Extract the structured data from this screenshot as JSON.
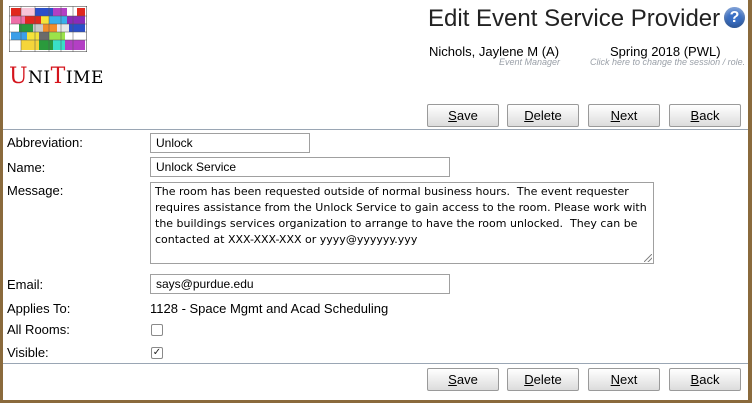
{
  "app": {
    "logo_uni": "Uni",
    "logo_time": "Time",
    "logo_u": "U",
    "logo_t": "T"
  },
  "header": {
    "title": "Edit Event Service Provider",
    "help_glyph": "?",
    "user": {
      "name": "Nichols, Jaylene M (A)",
      "role": "Event Manager"
    },
    "session": {
      "name": "Spring 2018 (PWL)",
      "hint": "Click here to change the session / role."
    }
  },
  "buttons": {
    "save": {
      "key": "S",
      "rest": "ave"
    },
    "delete": {
      "key": "D",
      "rest": "elete"
    },
    "next": {
      "key": "N",
      "rest": "ext"
    },
    "back": {
      "key": "B",
      "rest": "ack"
    }
  },
  "form": {
    "abbreviation": {
      "label": "Abbreviation:",
      "value": "Unlock"
    },
    "name": {
      "label": "Name:",
      "value": "Unlock Service"
    },
    "message": {
      "label": "Message:",
      "value": "The room has been requested outside of normal business hours.  The event requester requires assistance from the Unlock Service to gain access to the room. Please work with the buildings services organization to arrange to have the room unlocked.  They can be contacted at XXX-XXX-XXX or yyyy@yyyyyy.yyy"
    },
    "email": {
      "label": "Email:",
      "value": "says@purdue.edu"
    },
    "applies_to": {
      "label": "Applies To:",
      "value": "1128 - Space Mgmt and Acad Scheduling"
    },
    "all_rooms": {
      "label": "All Rooms:",
      "checked": false
    },
    "visible": {
      "label": "Visible:",
      "checked": true,
      "check_glyph": "✓"
    }
  },
  "colors": {
    "accent": "#3a6fc4",
    "frame": "#8a6a3c",
    "logo_red": "#d4141c"
  }
}
